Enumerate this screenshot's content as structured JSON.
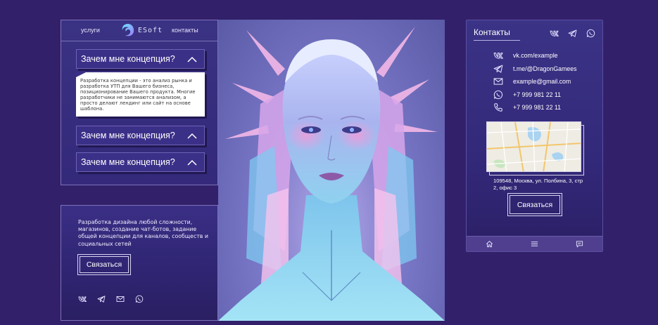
{
  "nav": {
    "services": "услуги",
    "brand": "ESoft",
    "contacts": "контакты"
  },
  "accordion": {
    "items": [
      {
        "title": "Зачем мне концепция?",
        "expanded": true
      },
      {
        "title": "Зачем мне концепция?",
        "expanded": false
      },
      {
        "title": "Зачем мне концепция?",
        "expanded": false
      }
    ],
    "body": "Разработка концепции - это анализ рынка и разработка УТП для Вашего бизнеса, позиционирование Вашего продукта. Многие разработчики не занимаются анализом, а просто делают лендинг или сайт на основе шаблона."
  },
  "promo": {
    "text": "Разработка дизайна любой сложности, магазинов, создание чат-ботов, задание общей концепции для каналов, сообществ и социальных сетей",
    "button": "Связаться",
    "social_icons": [
      "vk-icon",
      "telegram-icon",
      "mail-icon",
      "whatsapp-icon"
    ]
  },
  "panel": {
    "title": "Контакты",
    "header_icons": [
      "vk-icon",
      "telegram-icon",
      "whatsapp-icon"
    ],
    "contacts": [
      {
        "icon": "vk-icon",
        "text": "vk.com/example"
      },
      {
        "icon": "telegram-icon",
        "text": "t.me/@DragonGamees"
      },
      {
        "icon": "mail-icon",
        "text": "example@gmail.com"
      },
      {
        "icon": "whatsapp-icon",
        "text": "+7 999 981 22 11"
      },
      {
        "icon": "phone-icon",
        "text": "+7 999 981 22 11"
      }
    ],
    "address": "109548, Москва, ул. Полбина, 3, стр 2, офис 3",
    "button": "Связаться",
    "tabbar": [
      "home-icon",
      "menu-icon",
      "chat-icon"
    ]
  },
  "colors": {
    "background": "#33206a",
    "card": "#3a3283",
    "border": "#7d72b8"
  }
}
